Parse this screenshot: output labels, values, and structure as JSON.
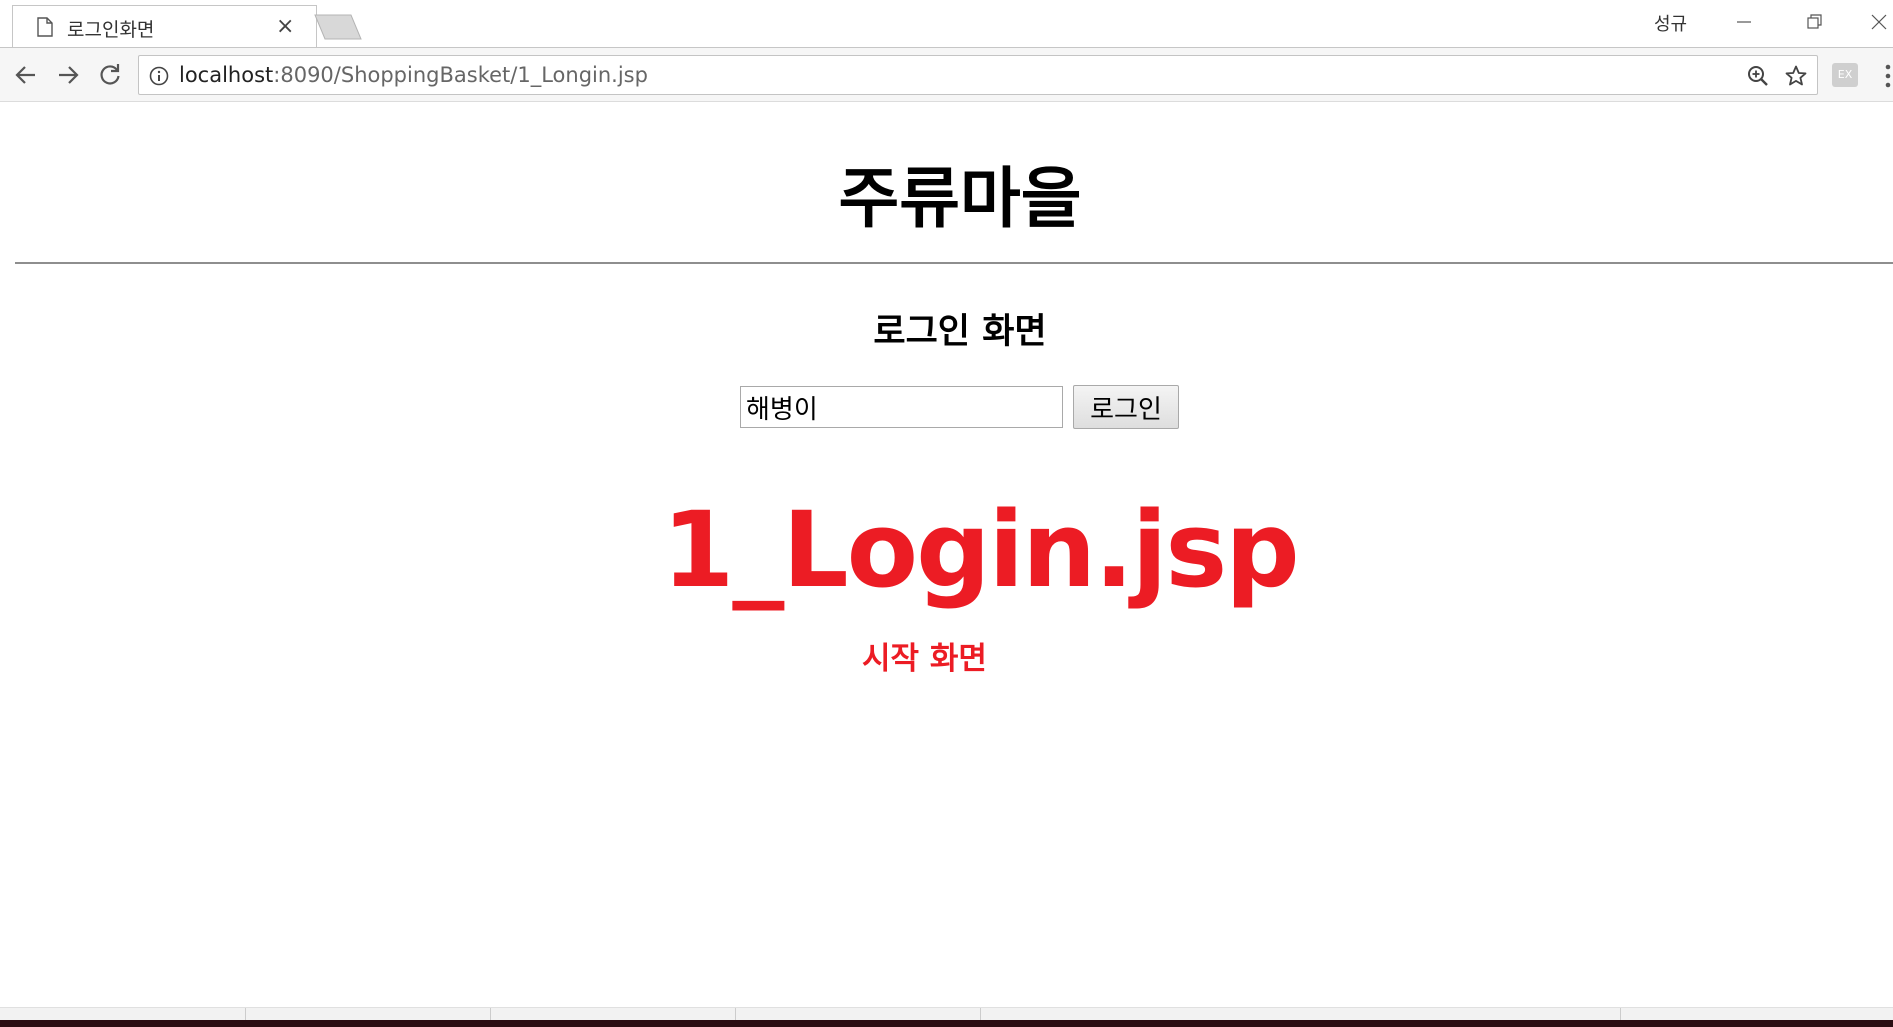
{
  "browser": {
    "tab_title": "로그인화면",
    "tab_close": "×",
    "profile_name": "성규",
    "url_host": "localhost",
    "url_rest": ":8090/ShoppingBasket/1_Longin.jsp",
    "ext_label": "EX"
  },
  "page": {
    "site_title": "주류마을",
    "login_heading": "로그인 화면",
    "login_input_value": "해병이",
    "login_button_label": "로그인"
  },
  "overlay": {
    "filename": "1_Login.jsp",
    "caption": "시작 화면",
    "color": "#ec1c24"
  }
}
